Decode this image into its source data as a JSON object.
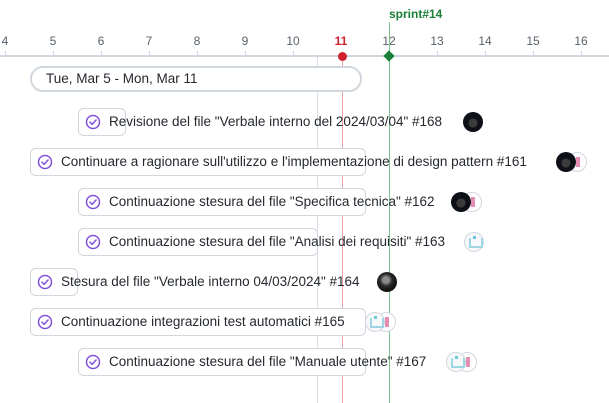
{
  "timeline": {
    "days": [
      "4",
      "5",
      "6",
      "7",
      "8",
      "9",
      "10",
      "11",
      "12",
      "13",
      "14",
      "15",
      "16"
    ],
    "today_day": "11",
    "sprint_label": "sprint#14"
  },
  "group": {
    "range_label": "Tue, Mar 5 - Mon, Mar 11"
  },
  "items": [
    {
      "title": "Revisione del file \"Verbale interno del 2024/03/04\" #168",
      "status": "done",
      "avatars": [
        "dark-avatar"
      ]
    },
    {
      "title": "Continuare a ragionare sull'utilizzo e l'implementazione di design pattern #161",
      "status": "done",
      "avatars": [
        "dark-avatar",
        "identicon-pink"
      ]
    },
    {
      "title": "Continuazione stesura del file \"Specifica tecnica\" #162",
      "status": "done",
      "avatars": [
        "dark-avatar",
        "identicon-pink"
      ]
    },
    {
      "title": "Continuazione stesura del file \"Analisi dei requisiti\" #163",
      "status": "done",
      "avatars": [
        "identicon-teal"
      ]
    },
    {
      "title": "Stesura del file \"Verbale interno 04/03/2024\" #164",
      "status": "done",
      "avatars": [
        "photo-avatar"
      ]
    },
    {
      "title": "Continuazione integrazioni test automatici #165",
      "status": "done",
      "avatars": [
        "identicon-teal",
        "identicon-pink"
      ]
    },
    {
      "title": "Continuazione stesura del file \"Manuale utente\" #167",
      "status": "done",
      "avatars": [
        "identicon-teal",
        "identicon-pink"
      ]
    }
  ],
  "colors": {
    "today": "#cf222e",
    "sprint": "#1a7f37",
    "done_check": "#8250df"
  }
}
